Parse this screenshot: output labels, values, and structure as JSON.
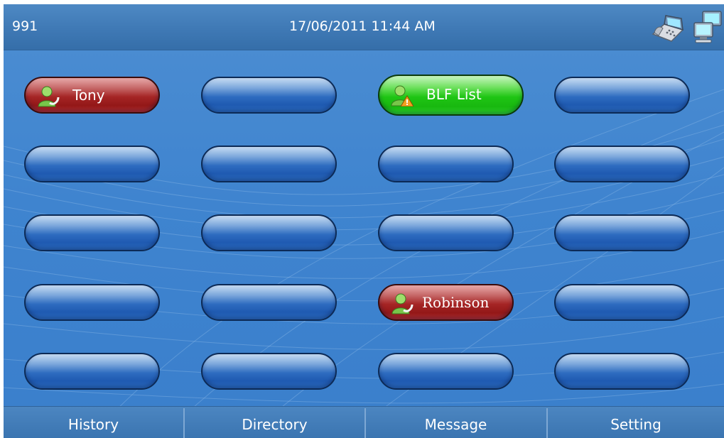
{
  "header": {
    "extension": "991",
    "datetime": "17/06/2011 11:44 AM",
    "icons": [
      "desk-phone-icon",
      "network-icon"
    ]
  },
  "grid": {
    "buttons": [
      {
        "label": "Tony",
        "state": "busy",
        "color": "#a52525",
        "icon": "person-call-icon"
      },
      {
        "label": "",
        "state": "empty"
      },
      {
        "label": "BLF List",
        "state": "ok",
        "color": "#1fc514",
        "icon": "person-warning-icon"
      },
      {
        "label": "",
        "state": "empty"
      },
      {
        "label": "",
        "state": "empty"
      },
      {
        "label": "",
        "state": "empty"
      },
      {
        "label": "",
        "state": "empty"
      },
      {
        "label": "",
        "state": "empty"
      },
      {
        "label": "",
        "state": "empty"
      },
      {
        "label": "",
        "state": "empty"
      },
      {
        "label": "",
        "state": "empty"
      },
      {
        "label": "",
        "state": "empty"
      },
      {
        "label": "",
        "state": "empty"
      },
      {
        "label": "",
        "state": "empty"
      },
      {
        "label": "Robinson",
        "state": "busy",
        "color": "#a52525",
        "icon": "person-call-icon"
      },
      {
        "label": "",
        "state": "empty"
      },
      {
        "label": "",
        "state": "empty"
      },
      {
        "label": "",
        "state": "empty"
      },
      {
        "label": "",
        "state": "empty"
      },
      {
        "label": "",
        "state": "empty"
      }
    ]
  },
  "footer": {
    "tabs": [
      "History",
      "Directory",
      "Message",
      "Setting"
    ]
  }
}
